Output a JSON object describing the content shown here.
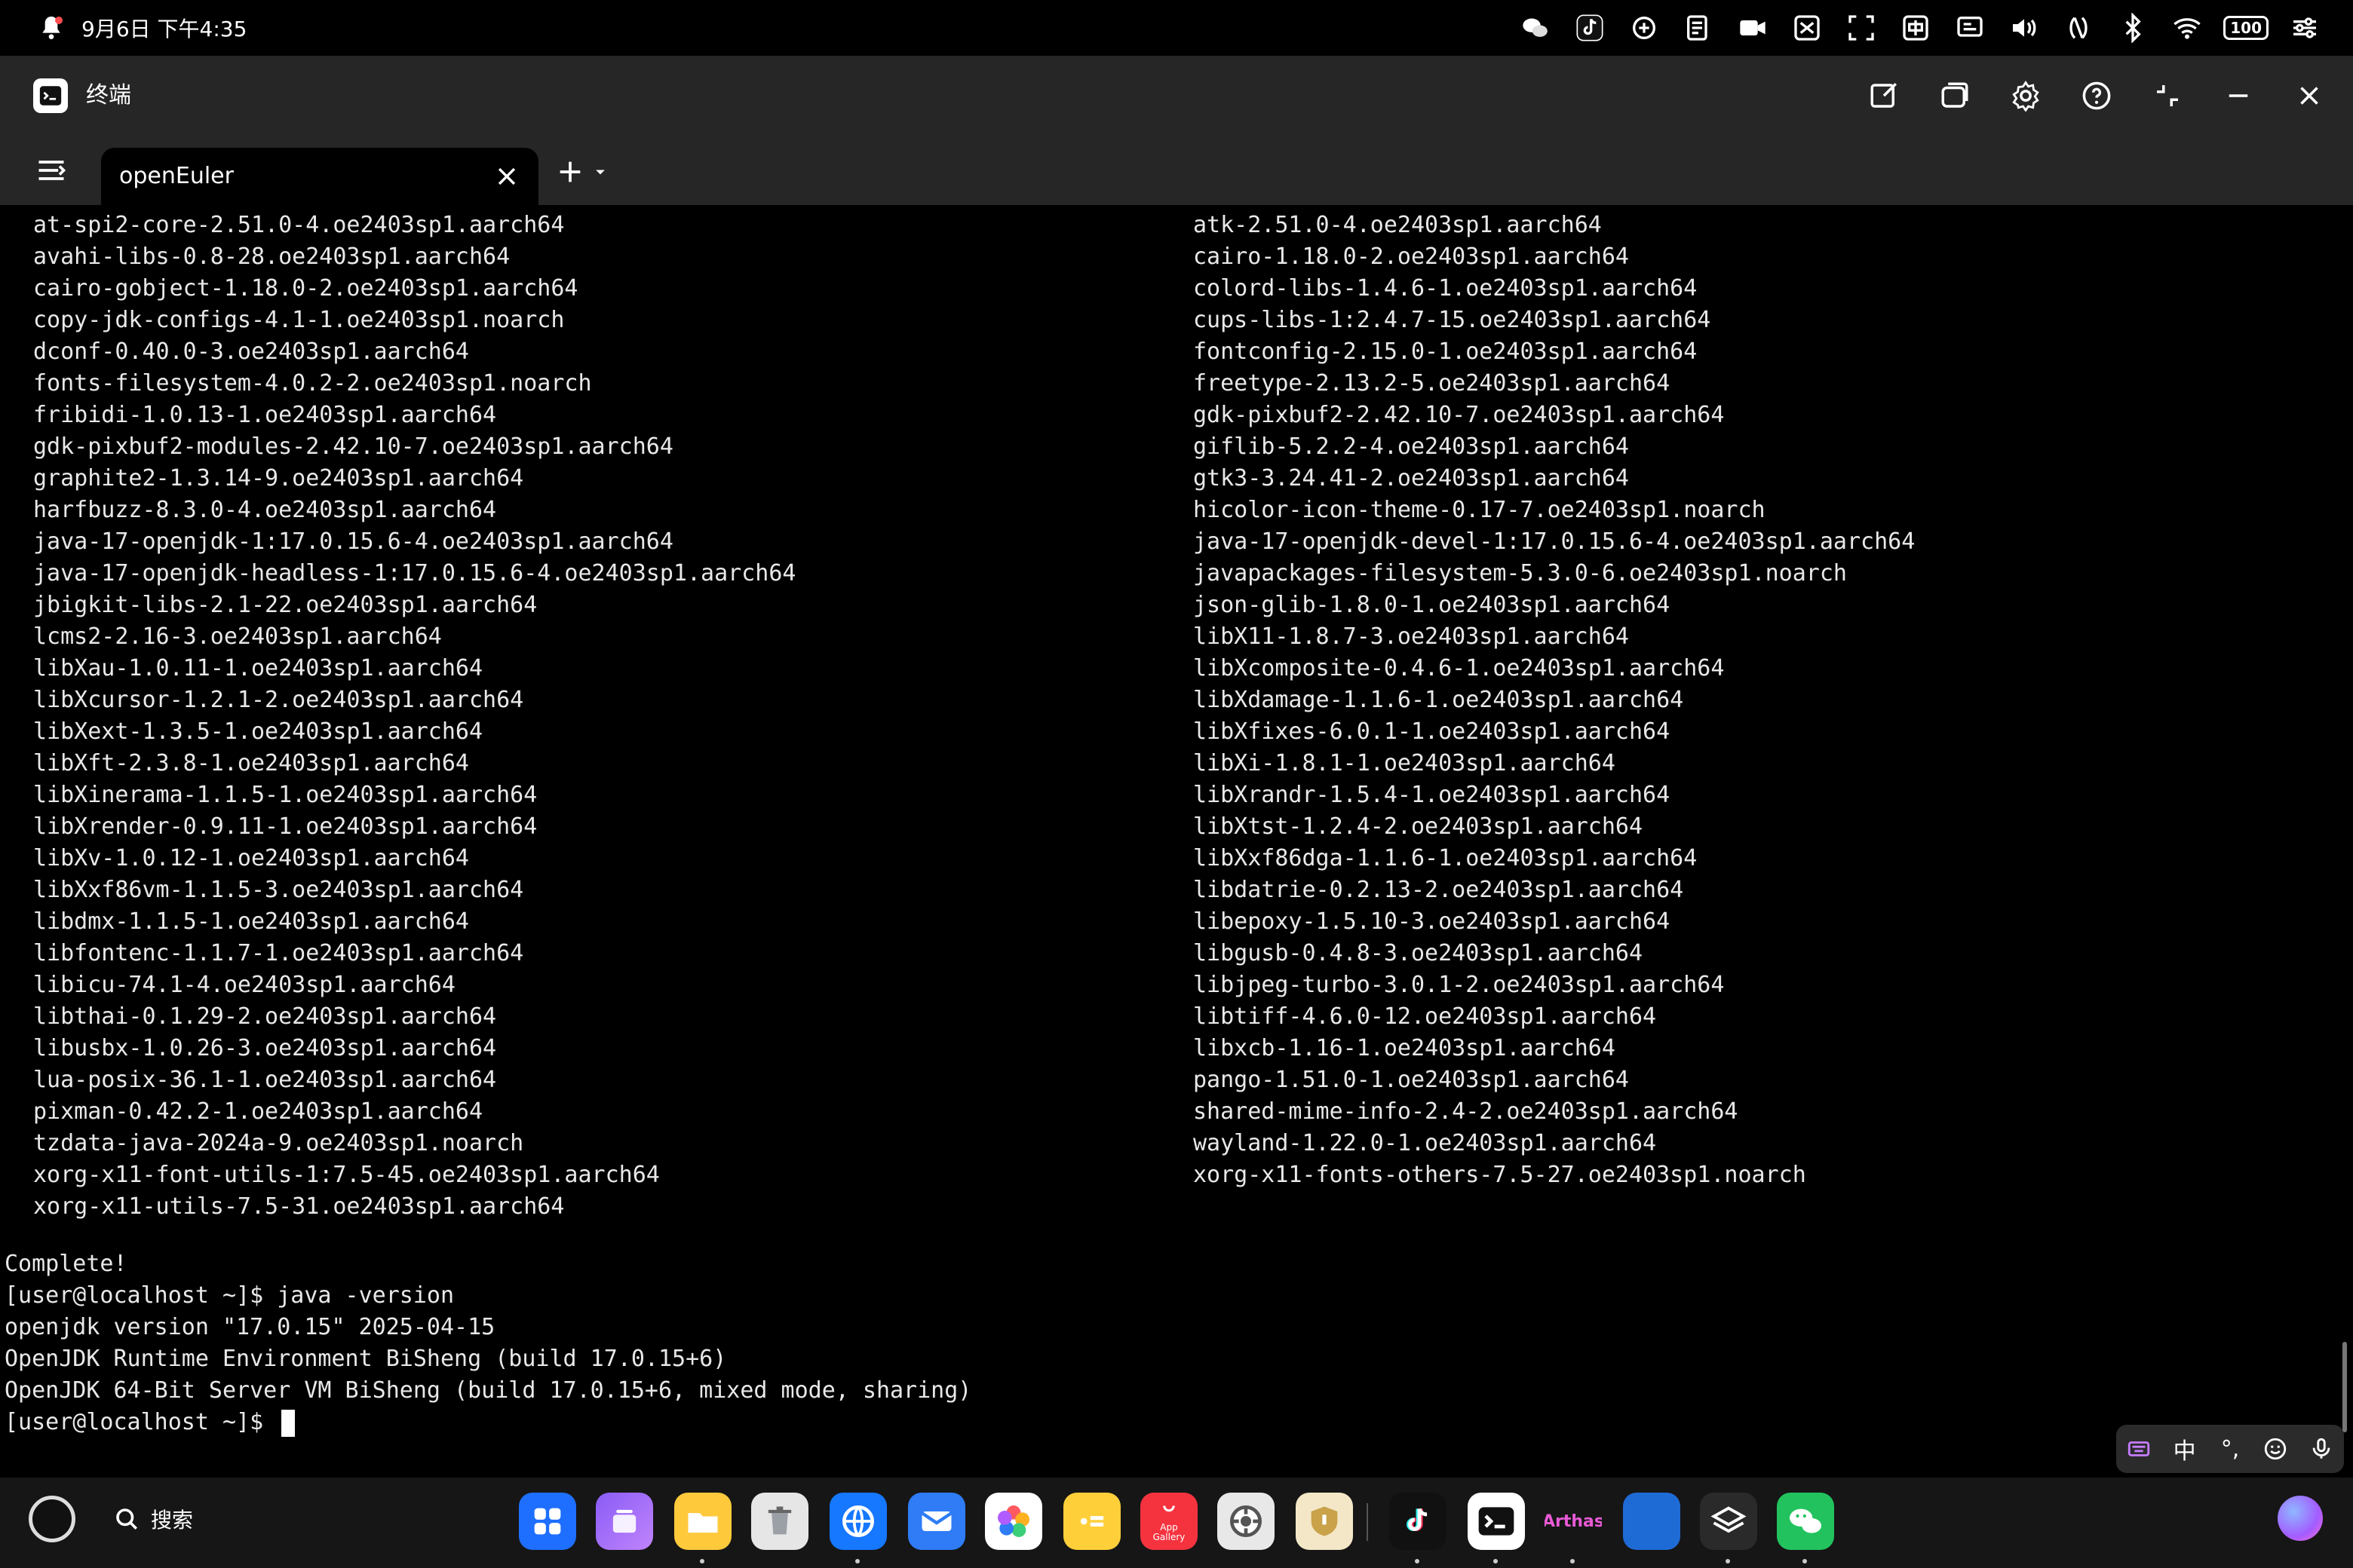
{
  "status_bar": {
    "datetime": "9月6日 下午4:35",
    "battery": "100"
  },
  "window": {
    "title": "终端"
  },
  "tabs": [
    {
      "label": "openEuler"
    }
  ],
  "terminal": {
    "packages_left": [
      "at-spi2-core-2.51.0-4.oe2403sp1.aarch64",
      "avahi-libs-0.8-28.oe2403sp1.aarch64",
      "cairo-gobject-1.18.0-2.oe2403sp1.aarch64",
      "copy-jdk-configs-4.1-1.oe2403sp1.noarch",
      "dconf-0.40.0-3.oe2403sp1.aarch64",
      "fonts-filesystem-4.0.2-2.oe2403sp1.noarch",
      "fribidi-1.0.13-1.oe2403sp1.aarch64",
      "gdk-pixbuf2-modules-2.42.10-7.oe2403sp1.aarch64",
      "graphite2-1.3.14-9.oe2403sp1.aarch64",
      "harfbuzz-8.3.0-4.oe2403sp1.aarch64",
      "java-17-openjdk-1:17.0.15.6-4.oe2403sp1.aarch64",
      "java-17-openjdk-headless-1:17.0.15.6-4.oe2403sp1.aarch64",
      "jbigkit-libs-2.1-22.oe2403sp1.aarch64",
      "lcms2-2.16-3.oe2403sp1.aarch64",
      "libXau-1.0.11-1.oe2403sp1.aarch64",
      "libXcursor-1.2.1-2.oe2403sp1.aarch64",
      "libXext-1.3.5-1.oe2403sp1.aarch64",
      "libXft-2.3.8-1.oe2403sp1.aarch64",
      "libXinerama-1.1.5-1.oe2403sp1.aarch64",
      "libXrender-0.9.11-1.oe2403sp1.aarch64",
      "libXv-1.0.12-1.oe2403sp1.aarch64",
      "libXxf86vm-1.1.5-3.oe2403sp1.aarch64",
      "libdmx-1.1.5-1.oe2403sp1.aarch64",
      "libfontenc-1.1.7-1.oe2403sp1.aarch64",
      "libicu-74.1-4.oe2403sp1.aarch64",
      "libthai-0.1.29-2.oe2403sp1.aarch64",
      "libusbx-1.0.26-3.oe2403sp1.aarch64",
      "lua-posix-36.1-1.oe2403sp1.aarch64",
      "pixman-0.42.2-1.oe2403sp1.aarch64",
      "tzdata-java-2024a-9.oe2403sp1.noarch",
      "xorg-x11-font-utils-1:7.5-45.oe2403sp1.aarch64",
      "xorg-x11-utils-7.5-31.oe2403sp1.aarch64"
    ],
    "packages_right": [
      "atk-2.51.0-4.oe2403sp1.aarch64",
      "cairo-1.18.0-2.oe2403sp1.aarch64",
      "colord-libs-1.4.6-1.oe2403sp1.aarch64",
      "cups-libs-1:2.4.7-15.oe2403sp1.aarch64",
      "fontconfig-2.15.0-1.oe2403sp1.aarch64",
      "freetype-2.13.2-5.oe2403sp1.aarch64",
      "gdk-pixbuf2-2.42.10-7.oe2403sp1.aarch64",
      "giflib-5.2.2-4.oe2403sp1.aarch64",
      "gtk3-3.24.41-2.oe2403sp1.aarch64",
      "hicolor-icon-theme-0.17-7.oe2403sp1.noarch",
      "java-17-openjdk-devel-1:17.0.15.6-4.oe2403sp1.aarch64",
      "javapackages-filesystem-5.3.0-6.oe2403sp1.noarch",
      "json-glib-1.8.0-1.oe2403sp1.aarch64",
      "libX11-1.8.7-3.oe2403sp1.aarch64",
      "libXcomposite-0.4.6-1.oe2403sp1.aarch64",
      "libXdamage-1.1.6-1.oe2403sp1.aarch64",
      "libXfixes-6.0.1-1.oe2403sp1.aarch64",
      "libXi-1.8.1-1.oe2403sp1.aarch64",
      "libXrandr-1.5.4-1.oe2403sp1.aarch64",
      "libXtst-1.2.4-2.oe2403sp1.aarch64",
      "libXxf86dga-1.1.6-1.oe2403sp1.aarch64",
      "libdatrie-0.2.13-2.oe2403sp1.aarch64",
      "libepoxy-1.5.10-3.oe2403sp1.aarch64",
      "libgusb-0.4.8-3.oe2403sp1.aarch64",
      "libjpeg-turbo-3.0.1-2.oe2403sp1.aarch64",
      "libtiff-4.6.0-12.oe2403sp1.aarch64",
      "libxcb-1.16-1.oe2403sp1.aarch64",
      "pango-1.51.0-1.oe2403sp1.aarch64",
      "shared-mime-info-2.4-2.oe2403sp1.aarch64",
      "wayland-1.22.0-1.oe2403sp1.aarch64",
      "xorg-x11-fonts-others-7.5-27.oe2403sp1.noarch"
    ],
    "tail_lines": [
      "Complete!",
      "[user@localhost ~]$ java -version",
      "openjdk version \"17.0.15\" 2025-04-15",
      "OpenJDK Runtime Environment BiSheng (build 17.0.15+6)",
      "OpenJDK 64-Bit Server VM BiSheng (build 17.0.15+6, mixed mode, sharing)"
    ],
    "prompt": "[user@localhost ~]$ "
  },
  "ime_toolbar": {
    "lang": "中",
    "punct": "°,"
  },
  "dock": {
    "search_label": "搜索",
    "arthas_label": "Arthas",
    "appgallery_label": "App Gallery",
    "apps": [
      "app-center",
      "multitask",
      "files",
      "recycle-bin",
      "browser",
      "mail",
      "gallery",
      "notes",
      "appgallery",
      "settings",
      "security",
      "tiktok",
      "terminal",
      "arthas",
      "blue-app",
      "layers",
      "wechat"
    ]
  },
  "colors": {
    "terminal_bg": "#000000",
    "chrome_bg": "#262626",
    "text": "#e8e8e8"
  }
}
